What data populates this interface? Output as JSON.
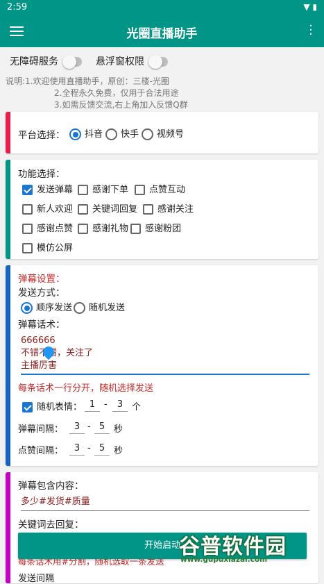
{
  "statusbar": {
    "time": "2:59"
  },
  "appbar": {
    "title": "光圈直播助手"
  },
  "top": {
    "accessibility_label": "无障碍服务",
    "overlay_label": "悬浮窗权限",
    "note1": "说明:1.欢迎使用直播助手，原创：三楼-光圈",
    "note2": "2.全程永久免费，仅用于合法用途",
    "note3": "3.如需反馈交流,右上角加入反馈Q群"
  },
  "platform": {
    "label": "平台选择：",
    "options": [
      "抖音",
      "快手",
      "视频号"
    ],
    "selected": "抖音",
    "accent": "#e91e4c"
  },
  "features": {
    "label": "功能选择：",
    "items": [
      {
        "label": "发送弹幕",
        "checked": true
      },
      {
        "label": "感谢下单",
        "checked": false
      },
      {
        "label": "点赞互动",
        "checked": false
      },
      {
        "label": "新人欢迎",
        "checked": false
      },
      {
        "label": "关键词回复",
        "checked": false
      },
      {
        "label": "感谢关注",
        "checked": false
      },
      {
        "label": "感谢点赞",
        "checked": false
      },
      {
        "label": "感谢礼物",
        "checked": false
      },
      {
        "label": "感谢粉团",
        "checked": false
      },
      {
        "label": "模仿公屏",
        "checked": false
      }
    ],
    "accent": "#009587"
  },
  "danmu": {
    "title": "弹幕设置：",
    "send_mode_label": "发送方式：",
    "send_modes": [
      "顺序发送",
      "随机发送"
    ],
    "selected_mode": "顺序发送",
    "script_label": "弹幕话术：",
    "script_lines": [
      "666666",
      "不错不错，关注了",
      "主播厉害"
    ],
    "hint": "每条话术一行分开，随机选择发送",
    "emoji_label": "随机表情：",
    "emoji_min": "1",
    "emoji_max": "3",
    "emoji_unit": "个",
    "interval_label": "弹幕间隔：",
    "interval_min": "3",
    "interval_max": "5",
    "interval_unit": "秒",
    "like_label": "点赞间隔：",
    "like_min": "3",
    "like_max": "5",
    "like_unit": "秒",
    "dash": "-",
    "accent": "#1565c0"
  },
  "keyword": {
    "contains_label": "弹幕包含内容：",
    "contains_value": "多少#发货#质量",
    "reply_label": "关键词去回复：",
    "reply_hint": "每条话术用#分割，随机选取一条发送",
    "partial_label": "发送间隔",
    "accent": "#c400c4"
  },
  "start_button": "开始启动",
  "watermark": {
    "text": "谷普软件园",
    "url": "www.gupuxiazai.com"
  }
}
